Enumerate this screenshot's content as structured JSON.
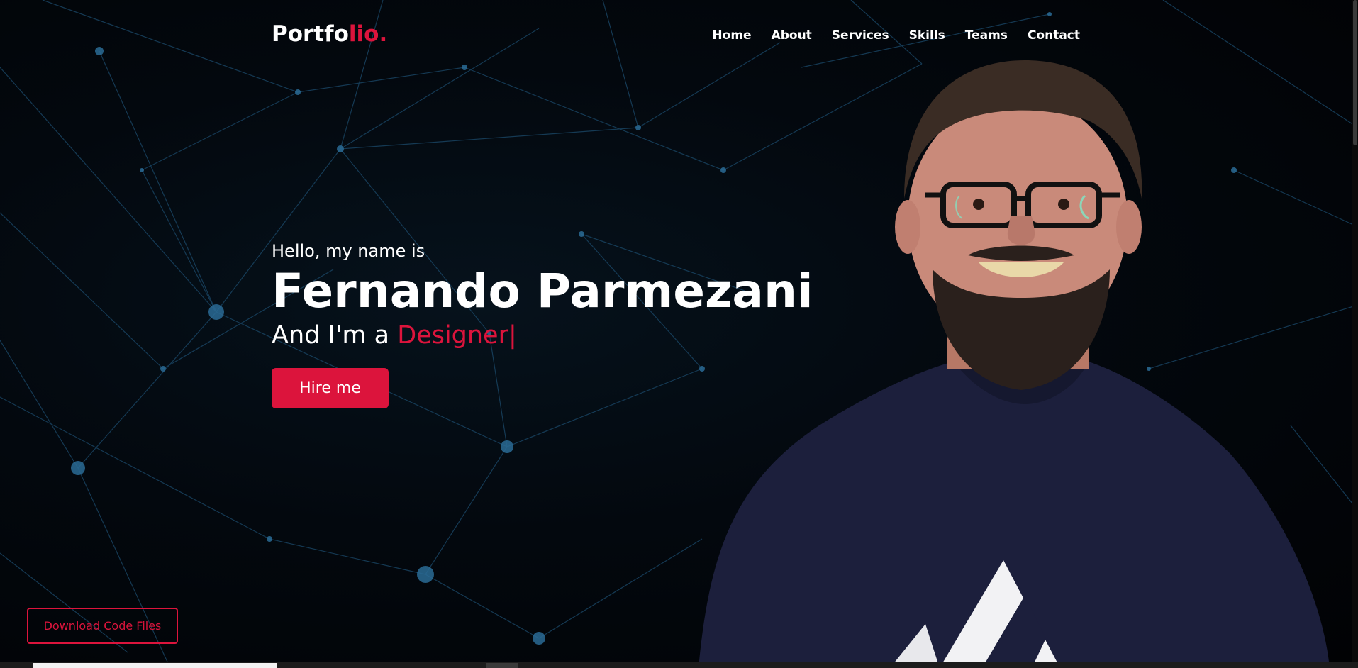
{
  "navbar": {
    "logo_main": "Portfo",
    "logo_accent": "lio.",
    "menu": [
      {
        "label": "Home"
      },
      {
        "label": "About"
      },
      {
        "label": "Services"
      },
      {
        "label": "Skills"
      },
      {
        "label": "Teams"
      },
      {
        "label": "Contact"
      }
    ]
  },
  "hero": {
    "greeting": "Hello, my name is",
    "name": "Fernando Parmezani",
    "role_prefix": "And I'm a ",
    "role_typed": "Designer|",
    "hire_button": "Hire me"
  },
  "download_button": "Download Code Files",
  "colors": {
    "accent": "#dc143c",
    "background": "#020407",
    "text": "#ffffff",
    "network_line": "#1b4a6b"
  },
  "icons": {
    "person_photo": "person-photo"
  }
}
